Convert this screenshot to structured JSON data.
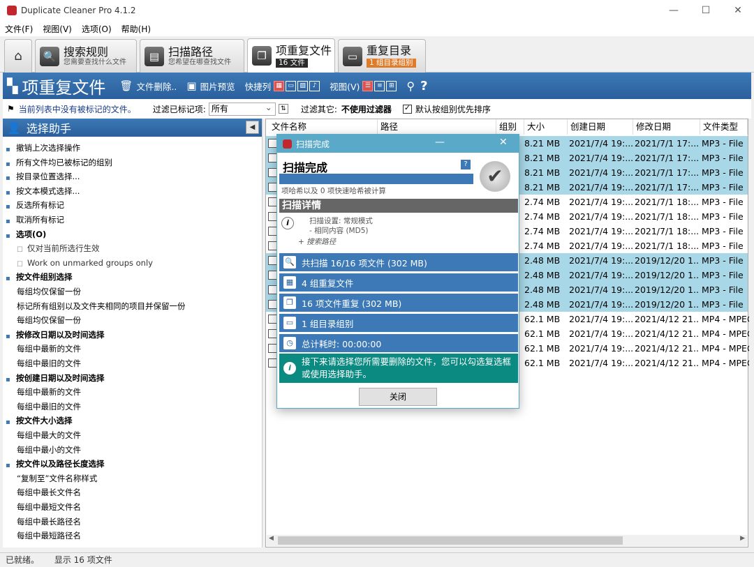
{
  "window": {
    "title": "Duplicate Cleaner Pro 4.1.2",
    "min": "—",
    "max": "☐",
    "close": "✕"
  },
  "menu": [
    "文件(F)",
    "视图(V)",
    "选项(O)",
    "帮助(H)"
  ],
  "tabs": [
    {
      "title": "搜索规则",
      "sub": "您需要查找什么文件",
      "icon": "🔍"
    },
    {
      "title": "扫描路径",
      "sub": "您希望在哪查找文件",
      "icon": "▤"
    },
    {
      "title": "项重复文件",
      "badge": "16 文件",
      "icon": "❐"
    },
    {
      "title": "重复目录",
      "badge": "1 组目录组别",
      "icon": "▭"
    }
  ],
  "toolbar": {
    "title": "项重复文件",
    "delete": "文件删除..",
    "preview": "图片预览",
    "quick": "快捷列",
    "view": "视图(V)"
  },
  "filter": {
    "notice": "当前列表中没有被标记的文件。",
    "label1": "过滤已标记项:",
    "select": "所有",
    "label2": "过滤其它:",
    "nofilter": "不使用过滤器",
    "sortlabel": "默认按组别优先排序"
  },
  "sidebar": {
    "title": "选择助手",
    "items": [
      {
        "t": "撤销上次选择操作",
        "k": "n"
      },
      {
        "t": "所有文件均已被标记的组别",
        "k": "n"
      },
      {
        "t": "按目录位置选择...",
        "k": "n"
      },
      {
        "t": "按文本模式选择...",
        "k": "n"
      },
      {
        "t": "反选所有标记",
        "k": "n"
      },
      {
        "t": "取消所有标记",
        "k": "n"
      },
      {
        "t": "选项(O)",
        "k": "h"
      },
      {
        "t": "仅对当前所选行生效",
        "k": "c"
      },
      {
        "t": "Work on unmarked groups only",
        "k": "c"
      },
      {
        "t": "按文件组别选择",
        "k": "h"
      },
      {
        "t": "每组均仅保留一份",
        "k": "s"
      },
      {
        "t": "标记所有组别以及文件夹相同的项目并保留一份",
        "k": "s"
      },
      {
        "t": "每组均仅保留一份",
        "k": "s"
      },
      {
        "t": "按修改日期以及时间选择",
        "k": "h"
      },
      {
        "t": "每组中最新的文件",
        "k": "s"
      },
      {
        "t": "每组中最旧的文件",
        "k": "s"
      },
      {
        "t": "按创建日期以及时间选择",
        "k": "h"
      },
      {
        "t": "每组中最新的文件",
        "k": "s"
      },
      {
        "t": "每组中最旧的文件",
        "k": "s"
      },
      {
        "t": "按文件大小选择",
        "k": "h"
      },
      {
        "t": "每组中最大的文件",
        "k": "s"
      },
      {
        "t": "每组中最小的文件",
        "k": "s"
      },
      {
        "t": "按文件以及路径长度选择",
        "k": "h"
      },
      {
        "t": "“复制至”文件名称样式",
        "k": "s"
      },
      {
        "t": "每组中最长文件名",
        "k": "s"
      },
      {
        "t": "每组中最短文件名",
        "k": "s"
      },
      {
        "t": "每组中最长路径名",
        "k": "s"
      },
      {
        "t": "每组中最短路径名",
        "k": "s"
      }
    ]
  },
  "grid": {
    "headers": [
      "文件名称",
      "路径",
      "组别",
      "大小",
      "创建日期",
      "修改日期",
      "文件类型"
    ],
    "rows": [
      {
        "size": "8.21 MB",
        "created": "2021/7/4 19:...",
        "modified": "2021/7/1 17:...",
        "type": "MP3 - File",
        "sel": true
      },
      {
        "size": "8.21 MB",
        "created": "2021/7/4 19:...",
        "modified": "2021/7/1 17:...",
        "type": "MP3 - File",
        "sel": true
      },
      {
        "size": "8.21 MB",
        "created": "2021/7/4 19:...",
        "modified": "2021/7/1 17:...",
        "type": "MP3 - File",
        "sel": true
      },
      {
        "size": "8.21 MB",
        "created": "2021/7/4 19:...",
        "modified": "2021/7/1 17:...",
        "type": "MP3 - File",
        "sel": true
      },
      {
        "size": "2.74 MB",
        "created": "2021/7/4 19:...",
        "modified": "2021/7/1 18:...",
        "type": "MP3 - File",
        "sel": false
      },
      {
        "size": "2.74 MB",
        "created": "2021/7/4 19:...",
        "modified": "2021/7/1 18:...",
        "type": "MP3 - File",
        "sel": false
      },
      {
        "size": "2.74 MB",
        "created": "2021/7/4 19:...",
        "modified": "2021/7/1 18:...",
        "type": "MP3 - File",
        "sel": false
      },
      {
        "size": "2.74 MB",
        "created": "2021/7/4 19:...",
        "modified": "2021/7/1 18:...",
        "type": "MP3 - File",
        "sel": false
      },
      {
        "size": "2.48 MB",
        "created": "2021/7/4 19:...",
        "modified": "2019/12/20 1...",
        "type": "MP3 - File",
        "sel": true
      },
      {
        "size": "2.48 MB",
        "created": "2021/7/4 19:...",
        "modified": "2019/12/20 1...",
        "type": "MP3 - File",
        "sel": true
      },
      {
        "size": "2.48 MB",
        "created": "2021/7/4 19:...",
        "modified": "2019/12/20 1...",
        "type": "MP3 - File",
        "sel": true
      },
      {
        "size": "2.48 MB",
        "created": "2021/7/4 19:...",
        "modified": "2019/12/20 1...",
        "type": "MP3 - File",
        "sel": true
      },
      {
        "size": "62.1 MB",
        "created": "2021/7/4 19:...",
        "modified": "2021/4/12 21...",
        "type": "MP4 - MPEG",
        "sel": false
      },
      {
        "size": "62.1 MB",
        "created": "2021/7/4 19:...",
        "modified": "2021/4/12 21...",
        "type": "MP4 - MPEG",
        "sel": false
      },
      {
        "size": "62.1 MB",
        "created": "2021/7/4 19:...",
        "modified": "2021/4/12 21...",
        "type": "MP4 - MPEG",
        "sel": false
      },
      {
        "size": "62.1 MB",
        "created": "2021/7/4 19:...",
        "modified": "2021/4/12 21...",
        "type": "MP4 - MPEG",
        "sel": false
      }
    ]
  },
  "dialog": {
    "title": "扫描完成",
    "heading": "扫描完成",
    "hashnote": "项哈希以及 0 项快速哈希被计算",
    "details": "扫描详情",
    "setting": "扫描设置: 常规模式",
    "content": "- 相同内容 (MD5)",
    "searchpath": "搜索路径",
    "rows": [
      {
        "icon": "🔍",
        "text": "共扫描 16/16 项文件 (302 MB)"
      },
      {
        "icon": "▦",
        "text": "4 组重复文件"
      },
      {
        "icon": "❐",
        "text": "16 项文件重复 (302 MB)"
      },
      {
        "icon": "▭",
        "text": "1 组目录组别"
      },
      {
        "icon": "◷",
        "text": "总计耗时: 00:00:00"
      }
    ],
    "next": "接下来请选择您所需要删除的文件，您可以勾选复选框或使用选择助手。",
    "close": "关闭"
  },
  "status": {
    "ready": "已就绪。",
    "shown": "显示 16 项文件"
  },
  "colors": {
    "accent": "#3c79b6",
    "dialog_title": "#5aa9c8",
    "teal": "#0a8a80",
    "selected_row": "#a8d8e8",
    "badge": "#e07b2a"
  }
}
